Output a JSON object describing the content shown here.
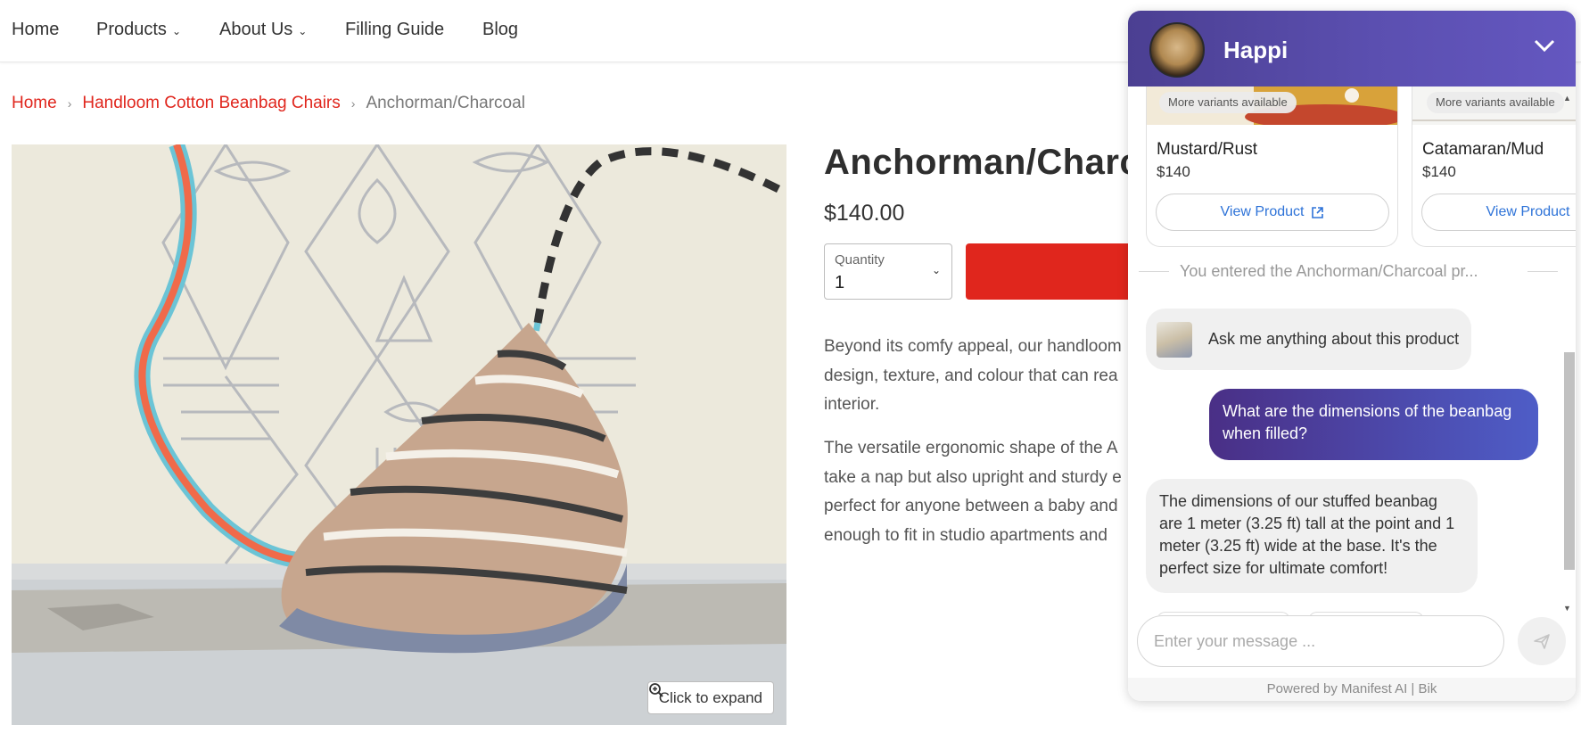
{
  "nav": {
    "items": [
      {
        "label": "Home",
        "has_dropdown": false
      },
      {
        "label": "Products",
        "has_dropdown": true
      },
      {
        "label": "About Us",
        "has_dropdown": true
      },
      {
        "label": "Filling Guide",
        "has_dropdown": false
      },
      {
        "label": "Blog",
        "has_dropdown": false
      }
    ]
  },
  "breadcrumb": {
    "home": "Home",
    "collection": "Handloom Cotton Beanbag Chairs",
    "current": "Anchorman/Charcoal"
  },
  "product": {
    "title": "Anchorman/Charco",
    "price": "$140.00",
    "quantity_label": "Quantity",
    "quantity_value": "1",
    "expand_label": "Click to expand",
    "desc1": [
      "Beyond its comfy appeal, our handloom",
      "design, texture, and colour that can rea",
      "interior."
    ],
    "desc2": [
      "The versatile ergonomic shape of the A",
      "take a nap but also upright and sturdy e",
      "perfect for anyone between a baby and",
      "enough to fit in studio apartments and"
    ]
  },
  "chat": {
    "name": "Happi",
    "cards": [
      {
        "variants": "More variants available",
        "name": "Mustard/Rust",
        "price": "$140",
        "button": "View Product"
      },
      {
        "variants": "More variants available",
        "name": "Catamaran/Mud",
        "price": "$140",
        "button": "View Product"
      }
    ],
    "context_note": "You entered the Anchorman/Charcoal pr...",
    "intro_message": "Ask me anything about this product",
    "user_message": "What are the dimensions of the beanbag when filled?",
    "bot_message": "The dimensions of our stuffed beanbag are 1 meter (3.25 ft) tall at the point and 1 meter (3.25 ft) wide at the base. It's the perfect size for ultimate comfort!",
    "input_placeholder": "Enter your message ...",
    "footer": "Powered by Manifest AI | Bik"
  },
  "colors": {
    "accent_red": "#e0261d",
    "chat_purple": "#5b4fb0",
    "link_blue": "#2e73d8"
  }
}
